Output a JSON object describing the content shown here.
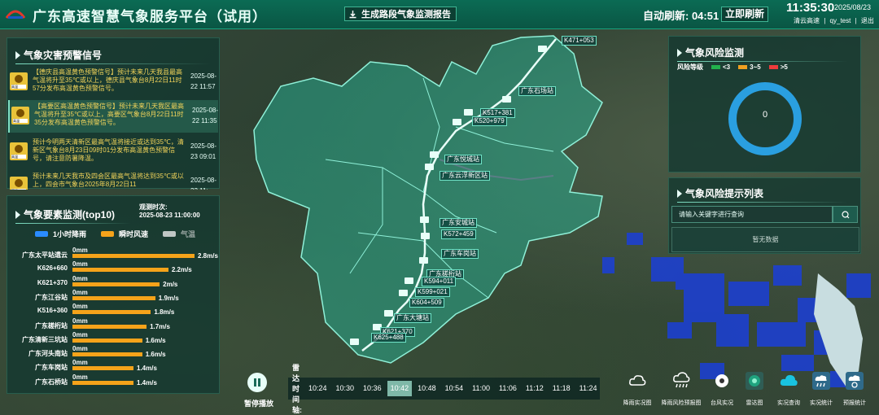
{
  "header": {
    "title": "广东高速智慧气象服务平台（试用）",
    "report_button": "生成路段气象监测报告",
    "refresh_label": "自动刷新: 04:51",
    "refresh_button": "立即刷新",
    "clock": "11:35:30",
    "date": "2025/08/23",
    "org": "清云高速",
    "user": "qy_test",
    "logout": "退出",
    "separator": "|"
  },
  "warnings": {
    "title": "气象灾害预警信号",
    "items": [
      {
        "text": "【德庆县高温黄色预警信号】预计未来几天我县最高气温将升至35℃或以上，德庆县气象台8月22日11时57分发布高温黄色预警信号。",
        "time": "2025-08-22 11:57",
        "badge": "高温"
      },
      {
        "text": "【高要区高温黄色预警信号】预计未来几天我区最高气温将升至35℃或以上，高要区气象台8月22日11时35分发布高温黄色预警信号。",
        "time": "2025-08-22 11:35",
        "badge": "高温"
      },
      {
        "text": "预计今明两天清新区最高气温将接近或达到35℃，清新区气象台8月23日09时01分发布高温黄色预警信号，请注意防暑降温。",
        "time": "2025-08-23 09:01",
        "badge": "高温"
      },
      {
        "text": "预计未来几天我市及四会区最高气温将达到35℃或以上，四会市气象台2025年8月22日11",
        "time": "2025-08-22 11:",
        "badge": "高温"
      }
    ]
  },
  "elements": {
    "title": "气象要素监测(top10)",
    "obs_label": "观测时次:",
    "obs_time": "2025-08-23 11:00:00",
    "legend": [
      {
        "label": "1小时降雨",
        "color": "#2a8cff"
      },
      {
        "label": "瞬时风速",
        "color": "#f5a31a"
      },
      {
        "label": "气温",
        "color": "#bfc6c4"
      }
    ],
    "rain_label": "0mm",
    "max_wind": 2.8,
    "rows": [
      {
        "name": "广东太平站遗云",
        "wind": 2.8,
        "wind_label": "2.8m/s"
      },
      {
        "name": "K626+660",
        "wind": 2.2,
        "wind_label": "2.2m/s"
      },
      {
        "name": "K621+370",
        "wind": 2.0,
        "wind_label": "2m/s"
      },
      {
        "name": "广东江谷站",
        "wind": 1.9,
        "wind_label": "1.9m/s"
      },
      {
        "name": "K516+360",
        "wind": 1.8,
        "wind_label": "1.8m/s"
      },
      {
        "name": "广东槎桁站",
        "wind": 1.7,
        "wind_label": "1.7m/s"
      },
      {
        "name": "广东清新三坑站",
        "wind": 1.6,
        "wind_label": "1.6m/s"
      },
      {
        "name": "广东河头南站",
        "wind": 1.6,
        "wind_label": "1.6m/s"
      },
      {
        "name": "广东车岗站",
        "wind": 1.4,
        "wind_label": "1.4m/s"
      },
      {
        "name": "广东石桥站",
        "wind": 1.4,
        "wind_label": "1.4m/s"
      }
    ]
  },
  "risk": {
    "title": "气象风险监测",
    "level_label": "风险等级",
    "levels": [
      {
        "label": "<3",
        "color": "#22b24c"
      },
      {
        "label": "3~5",
        "color": "#f0a020"
      },
      {
        "label": ">5",
        "color": "#ee3b3b"
      }
    ],
    "count": "0",
    "ring_color": "#2a9fe0"
  },
  "risk_list": {
    "title": "气象风险提示列表",
    "search_placeholder": "请输入关键字进行查询",
    "no_data": "暂无数据"
  },
  "playback": {
    "label": "暂停播放",
    "radar_label": "雷达时间轴:",
    "times": [
      "10:24",
      "10:30",
      "10:36",
      "10:42",
      "10:48",
      "10:54",
      "11:00",
      "11:06",
      "11:12",
      "11:18",
      "11:24"
    ],
    "active_time": "10:42"
  },
  "tools": [
    {
      "label": "降雨实况图",
      "icon": "cloud-icon"
    },
    {
      "label": "降雨风险预报图",
      "icon": "cloud-rain-icon"
    },
    {
      "label": "台风实况",
      "icon": "typhoon-icon"
    },
    {
      "label": "雷达图",
      "icon": "radar-icon"
    },
    {
      "label": "实况查询",
      "icon": "cloud-search-icon"
    },
    {
      "label": "实况统计",
      "icon": "weather-stats-icon"
    },
    {
      "label": "预报统计",
      "icon": "forecast-stats-icon"
    }
  ],
  "map_labels": [
    "K471+053",
    "广东石场站",
    "K517+381",
    "K520+979",
    "广东悦城站",
    "广东云浮新区站",
    "广东安城站",
    "K572+459",
    "广东车岗站",
    "广东槎桁站",
    "K594+011",
    "K599+021",
    "K604+509",
    "广东大塘站",
    "K621+370",
    "K625+488"
  ]
}
